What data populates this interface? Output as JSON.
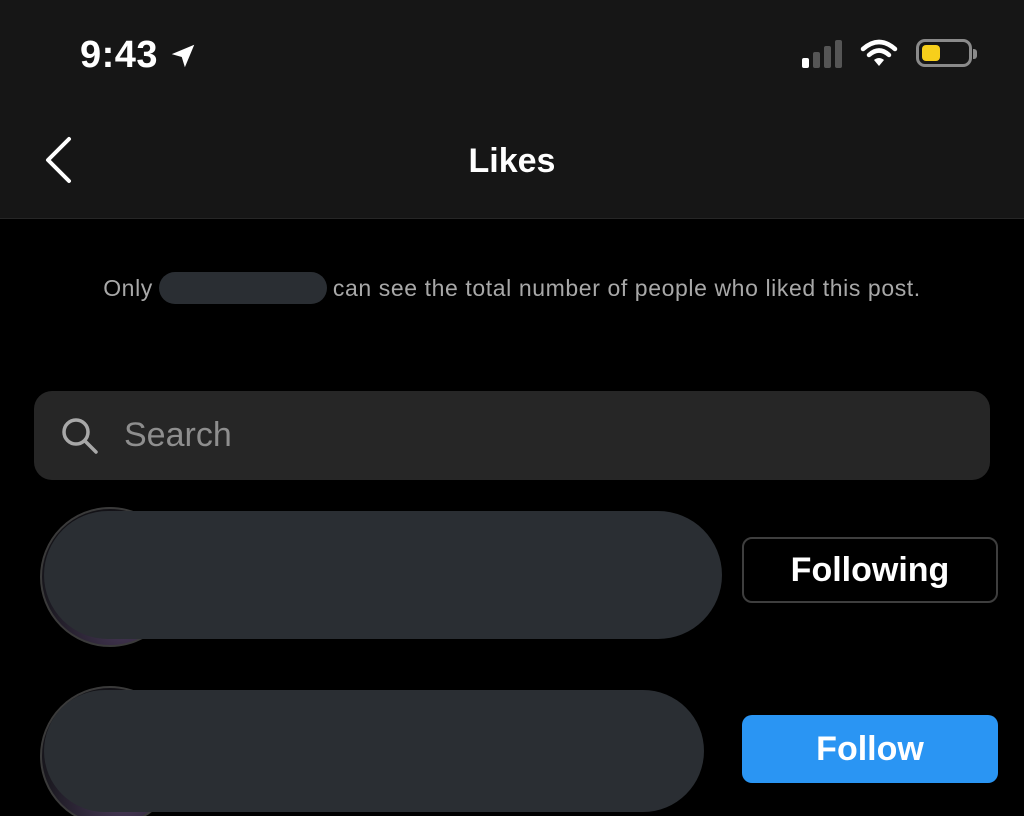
{
  "status_bar": {
    "time": "9:43",
    "battery_level": 0.4,
    "battery_color": "#f7cf1b",
    "signal_bars_active": 1,
    "signal_bars_total": 4,
    "icons": [
      "location-arrow-icon",
      "cellular-signal-icon",
      "wifi-icon",
      "battery-icon"
    ]
  },
  "header": {
    "title": "Likes",
    "back_icon": "chevron-left-icon"
  },
  "notice": {
    "prefix": "Only",
    "suffix": "can see the total number of people who liked this post."
  },
  "search": {
    "placeholder": "Search",
    "value": "",
    "icon": "search-icon"
  },
  "likers": [
    {
      "name": "",
      "button_label": "Following",
      "following": true
    },
    {
      "name": "",
      "button_label": "Follow",
      "following": false
    }
  ],
  "colors": {
    "follow_button": "#2a95f3",
    "background": "#000000",
    "header_background": "#161616"
  }
}
